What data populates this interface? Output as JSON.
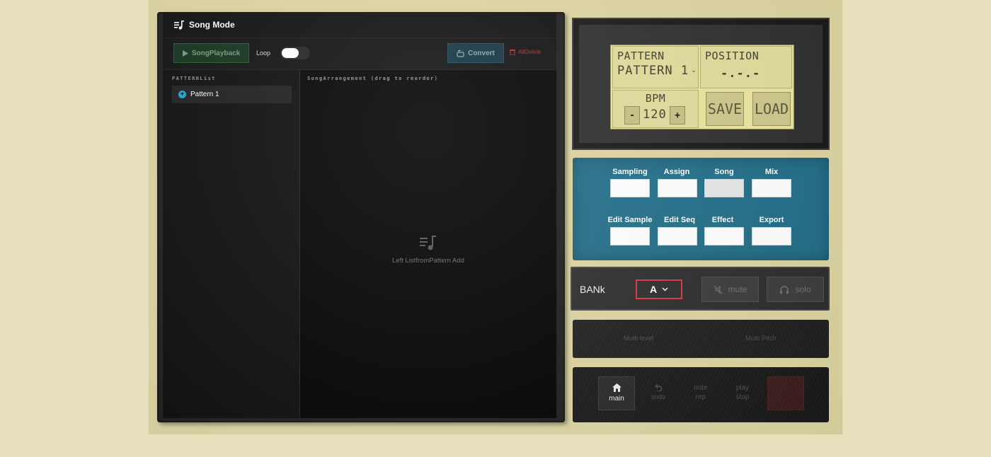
{
  "song_mode": {
    "title": "Song Mode",
    "playback_label": "SongPlayback",
    "loop_label": "Loop",
    "loop_on": true,
    "convert_label": "Convert",
    "alldelete_label": "AllDelete",
    "pattern_list_label": "PATTERNList",
    "patterns": [
      "Pattern 1"
    ],
    "arrangement_label": "SongArrangement (drag to reorder)",
    "empty_text": "Left ListfromPattern Add"
  },
  "lcd": {
    "pattern_title": "PATTERN",
    "pattern_value": "PATTERN 1",
    "position_title": "POSITION",
    "position_value": "-.-.-",
    "bpm_title": "BPM",
    "bpm_value": "120",
    "minus": "-",
    "plus": "+",
    "save_label": "SAVE",
    "load_label": "LOAD"
  },
  "modes": {
    "row1": [
      "Sampling",
      "Assign",
      "Song",
      "Mix"
    ],
    "row2": [
      "Edit Sample",
      "Edit Seq",
      "Effect",
      "Export"
    ],
    "active": "Song"
  },
  "bank": {
    "label": "BANk",
    "selected": "A",
    "mute_label": "mute",
    "solo_label": "solo"
  },
  "multi": {
    "level_label": "Multi level",
    "pitch_label": "Multi Pitch"
  },
  "transport": {
    "main_label": "main",
    "undo_label": "undo",
    "note_rep_line1": "note",
    "note_rep_line2": "rep",
    "play_stop_line1": "play",
    "play_stop_line2": "stop"
  },
  "colors": {
    "background": "#e5dfbb",
    "lcd": "#eae59a",
    "mode_panel": "#1f6c87",
    "accent_blue": "#1fa1d1",
    "delete_red": "#b22e2e",
    "bank_border": "#e0313a"
  }
}
